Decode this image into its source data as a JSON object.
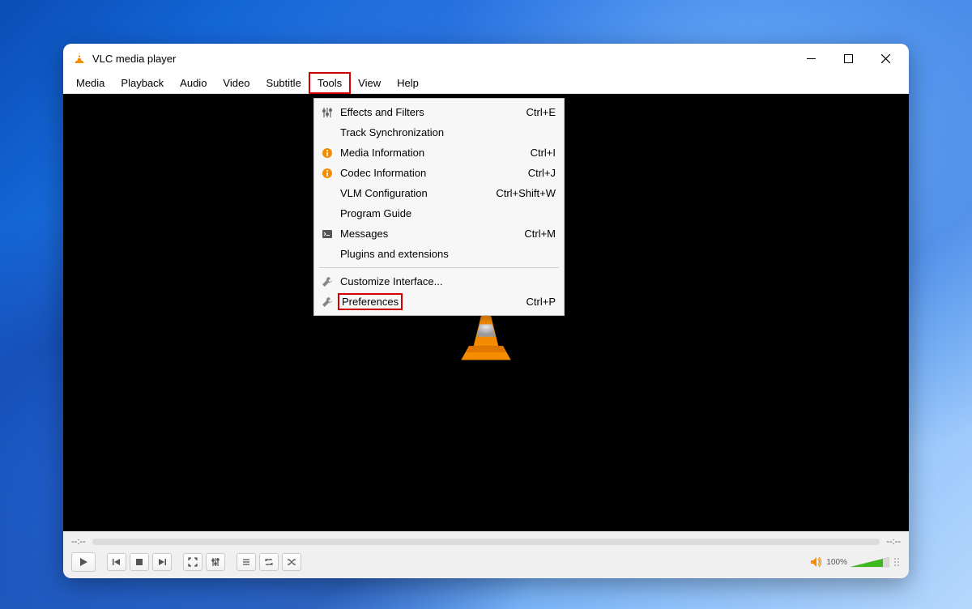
{
  "titlebar": {
    "title": "VLC media player"
  },
  "menubar": {
    "items": [
      "Media",
      "Playback",
      "Audio",
      "Video",
      "Subtitle",
      "Tools",
      "View",
      "Help"
    ],
    "highlighted_index": 5
  },
  "dropdown": {
    "items": [
      {
        "icon": "sliders-icon",
        "label": "Effects and Filters",
        "shortcut": "Ctrl+E"
      },
      {
        "icon": "",
        "label": "Track Synchronization",
        "shortcut": ""
      },
      {
        "icon": "info-icon",
        "label": "Media Information",
        "shortcut": "Ctrl+I"
      },
      {
        "icon": "info-icon",
        "label": "Codec Information",
        "shortcut": "Ctrl+J"
      },
      {
        "icon": "",
        "label": "VLM Configuration",
        "shortcut": "Ctrl+Shift+W"
      },
      {
        "icon": "",
        "label": "Program Guide",
        "shortcut": ""
      },
      {
        "icon": "terminal-icon",
        "label": "Messages",
        "shortcut": "Ctrl+M"
      },
      {
        "icon": "",
        "label": "Plugins and extensions",
        "shortcut": ""
      },
      {
        "separator": true
      },
      {
        "icon": "wrench-icon",
        "label": "Customize Interface...",
        "shortcut": ""
      },
      {
        "icon": "wrench-icon",
        "label": "Preferences",
        "shortcut": "Ctrl+P",
        "boxed": true
      }
    ]
  },
  "controls": {
    "time_left": "--:--",
    "time_right": "--:--",
    "volume_pct": "100%"
  }
}
